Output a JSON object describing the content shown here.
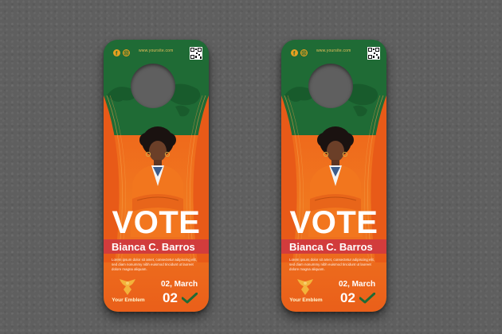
{
  "hangers": [
    {
      "website": "www.yoursite.com",
      "title": "VOTE",
      "candidate_name": "Bianca C. Barros",
      "description": "Lorem ipsum dolor sit amet, consectetur adipiscing elit, sed diam nonummy nibh euismod tincidunt ut laoreet dolore magna aliquam.",
      "date_line": "02, March",
      "big_number": "02",
      "emblem_label": "Your Emblem"
    },
    {
      "website": "www.yoursite.com",
      "title": "VOTE",
      "candidate_name": "Bianca C. Barros",
      "description": "Lorem ipsum dolor sit amet, consectetur adipiscing elit, sed diam nonummy nibh euismod tincidunt ut laoreet dolore magna aliquam.",
      "date_line": "02, March",
      "big_number": "02",
      "emblem_label": "Your Emblem"
    }
  ],
  "icons": [
    "facebook-icon",
    "instagram-icon",
    "qr-code-icon",
    "eagle-emblem-icon",
    "checkmark-icon"
  ],
  "colors": {
    "background": "#5f5f5f",
    "green": "#1f6b35",
    "orange": "#ef6a1c",
    "red_bar": "#d23c3c",
    "gold": "#e8a020"
  }
}
